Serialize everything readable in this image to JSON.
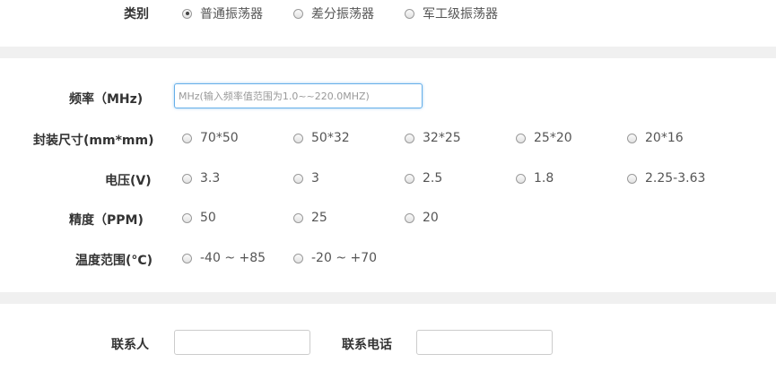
{
  "category": {
    "label": "类别",
    "options": [
      {
        "label": "普通振荡器",
        "checked": true
      },
      {
        "label": "差分振荡器",
        "checked": false
      },
      {
        "label": "军工级振荡器",
        "checked": false
      }
    ]
  },
  "frequency": {
    "label": "频率（MHz)",
    "value": "",
    "placeholder": "MHz(输入频率值范围为1.0~~220.0MHZ)"
  },
  "package_size": {
    "label": "封装尺寸(mm*mm)",
    "options": [
      "70*50",
      "50*32",
      "32*25",
      "25*20",
      "20*16"
    ]
  },
  "voltage": {
    "label": "电压(V)",
    "options": [
      "3.3",
      "3",
      "2.5",
      "1.8",
      "2.25-3.63"
    ]
  },
  "precision": {
    "label": "精度（PPM)",
    "options": [
      "50",
      "25",
      "20"
    ]
  },
  "temperature": {
    "label": "温度范围(°C)",
    "options": [
      "-40 ~ +85",
      "-20 ~ +70"
    ]
  },
  "contact": {
    "name_label": "联系人",
    "name_value": "",
    "phone_label": "联系电话",
    "phone_value": ""
  },
  "colors": {
    "section_divider": "#f0f0f0",
    "focus_border": "#66afe9",
    "label_text": "#333333",
    "option_text": "#555555"
  }
}
